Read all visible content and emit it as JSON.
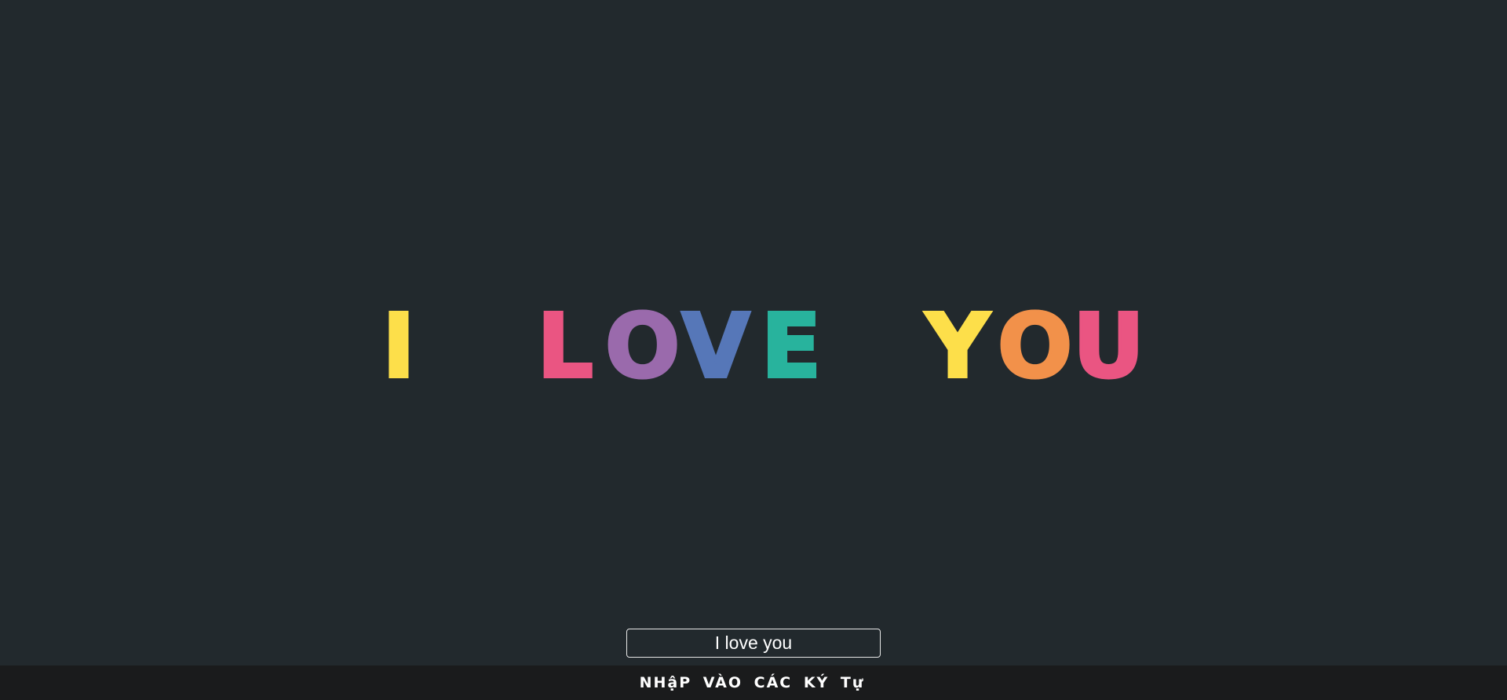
{
  "display": {
    "letters": [
      {
        "char": "I",
        "color": "#fddf4a"
      },
      {
        "char": " ",
        "color": ""
      },
      {
        "char": "L",
        "color": "#ea5582"
      },
      {
        "char": "O",
        "color": "#9a6aac"
      },
      {
        "char": "V",
        "color": "#5677b8"
      },
      {
        "char": "E",
        "color": "#28b39d"
      },
      {
        "char": " ",
        "color": ""
      },
      {
        "char": "Y",
        "color": "#fddf4a"
      },
      {
        "char": "O",
        "color": "#f2914a"
      },
      {
        "char": "U",
        "color": "#ea5582"
      }
    ]
  },
  "input": {
    "value": "I love you",
    "placeholder": ""
  },
  "footer": {
    "label": "NHậP VÀO CÁC KÝ Tự"
  },
  "colors": {
    "background": "#22292d",
    "footer_background": "#1a1b1c",
    "input_border": "#e8e8e8"
  }
}
